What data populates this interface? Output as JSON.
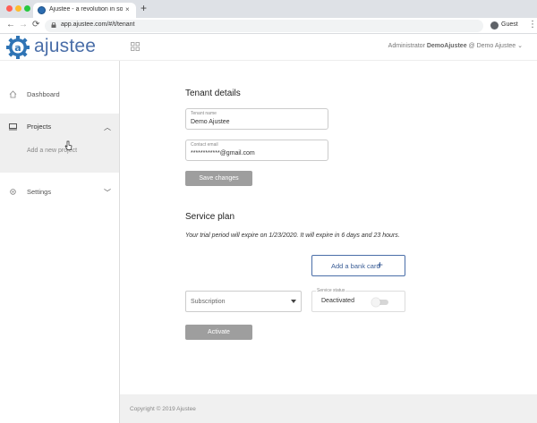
{
  "browser": {
    "tab_title": "Ajustee - a revolution in software",
    "tab_close": "×",
    "new_tab": "+",
    "back": "←",
    "forward": "→",
    "reload": "⟳",
    "url": "app.ajustee.com/#/t/tenant",
    "profile_name": "Guest",
    "menu": "⋮"
  },
  "header": {
    "logo_text": "ajustee",
    "user_prefix": "Administrator",
    "user_name": "DemoAjustee",
    "tenant_suffix": "@ Demo Ajustee ⌄"
  },
  "sidebar": {
    "dashboard_label": "Dashboard",
    "projects_label": "Projects",
    "projects_chevron": "︿",
    "add_project_label": "Add a new project",
    "settings_label": "Settings",
    "settings_chevron": "﹀"
  },
  "tenant_details": {
    "title": "Tenant details",
    "name_label": "Tenant name",
    "name_value": "Demo Ajustee",
    "email_label": "Contact email",
    "email_value": "************@gmail.com",
    "save_label": "Save changes"
  },
  "service_plan": {
    "title": "Service plan",
    "trial_text": "Your trial period will expire on 1/23/2020. It will expire in 6 days and 23 hours.",
    "bank_card_label": "Add a bank card",
    "bank_card_icon": "+",
    "subscription_placeholder": "Subscription",
    "status_label": "Service status",
    "status_value": "Deactivated",
    "status_on": false,
    "activate_label": "Activate"
  },
  "footer": {
    "copyright": "Copyright © 2019 Ajustee"
  }
}
